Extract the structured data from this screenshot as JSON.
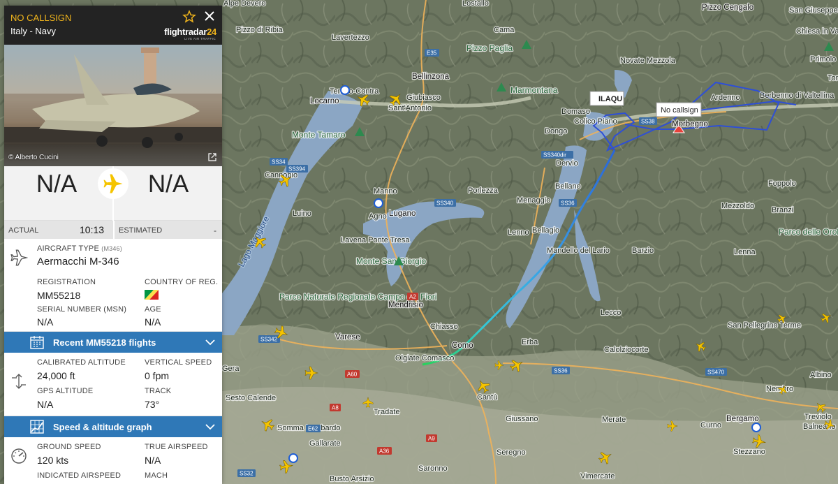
{
  "panel": {
    "callsign": "NO CALLSIGN",
    "operator": "Italy - Navy",
    "logo_text": "flightradar",
    "logo_num": "24",
    "logo_tagline": "LIVE AIR TRAFFIC",
    "photo_credit": "© Alberto Cucini",
    "origin": "N/A",
    "destination": "N/A",
    "actual_label": "ACTUAL",
    "actual_time": "10:13",
    "estimated_label": "ESTIMATED",
    "estimated_time": "-",
    "aircraft_type_label": "AIRCRAFT TYPE",
    "aircraft_type_code": "(M346)",
    "aircraft_type": "Aermacchi M-346",
    "registration_label": "REGISTRATION",
    "registration": "MM55218",
    "country_label": "COUNTRY OF REG.",
    "serial_label": "SERIAL NUMBER (MSN)",
    "serial": "N/A",
    "age_label": "AGE",
    "age": "N/A",
    "recent_flights": "Recent MM55218 flights",
    "cal_alt_label": "CALIBRATED ALTITUDE",
    "cal_alt": "24,000 ft",
    "vs_label": "VERTICAL SPEED",
    "vs": "0 fpm",
    "gps_alt_label": "GPS ALTITUDE",
    "gps_alt": "N/A",
    "track_label": "TRACK",
    "track": "73°",
    "speed_graph": "Speed & altitude graph",
    "gs_label": "GROUND SPEED",
    "gs": "120 kts",
    "tas_label": "TRUE AIRSPEED",
    "tas": "N/A",
    "ias_label": "INDICATED AIRSPEED",
    "mach_label": "MACH"
  },
  "map": {
    "tooltip_callsign": "No callsign",
    "tooltip_other": "ILAQU",
    "places": [
      "Alpe Devero",
      "Lostallo",
      "Pizzo Cengalo",
      "San Giuseppe",
      "Pizzo di Ribia",
      "Lavertezzo",
      "Cama",
      "Chiesa in Valmalenco",
      "Pizzo Paglia",
      "Primolo",
      "Novate Mezzola",
      "Bellinzona",
      "Marmontana",
      "Torre",
      "Tenero-Contra",
      "Giubiasco",
      "Ardenno",
      "Morbegno",
      "Berbenno di Valtellina",
      "Locarno",
      "Sant'Antonio",
      "Domaso",
      "Colico Piano",
      "Dongo",
      "Monte Tamaro",
      "Dervio",
      "Cannobio",
      "Manno",
      "Porlezza",
      "Bellano",
      "Foppolo",
      "Lugano",
      "Menaggio",
      "Agno",
      "Mezzoldo",
      "Luino",
      "Branzi",
      "Lenno",
      "Bellagio",
      "Lavena Ponte Tresa",
      "Parco delle Orobie Bergamasche",
      "Monte San Giorgio",
      "Barzio",
      "Mandello del Lario",
      "Lenna",
      "Mendrisio",
      "Parco Naturale Regionale Campo dei Fiori",
      "Lecco",
      "San Pellegrino Terme",
      "Chiasso",
      "Varese",
      "Como",
      "Erba",
      "Olgiate Comasco",
      "Calolziocorte",
      "Gera",
      "Albino",
      "Cantù",
      "Nembro",
      "Sesto Calende",
      "Tradate",
      "Somma Lombardo",
      "Giussano",
      "Merate",
      "Curno",
      "Bergamo",
      "Treviolo",
      "Balneario",
      "Gallarate",
      "Seregno",
      "Stezzano",
      "Saronno",
      "Busto Arsizio",
      "Vimercate",
      "Lago Maggiore"
    ],
    "roads": [
      "E35",
      "SS34",
      "SS394",
      "SS340",
      "SS340dir",
      "SS36",
      "SS38",
      "A9",
      "SS342",
      "E62",
      "A8",
      "A60",
      "SS36",
      "SS470",
      "A36",
      "SS32",
      "A2"
    ]
  }
}
